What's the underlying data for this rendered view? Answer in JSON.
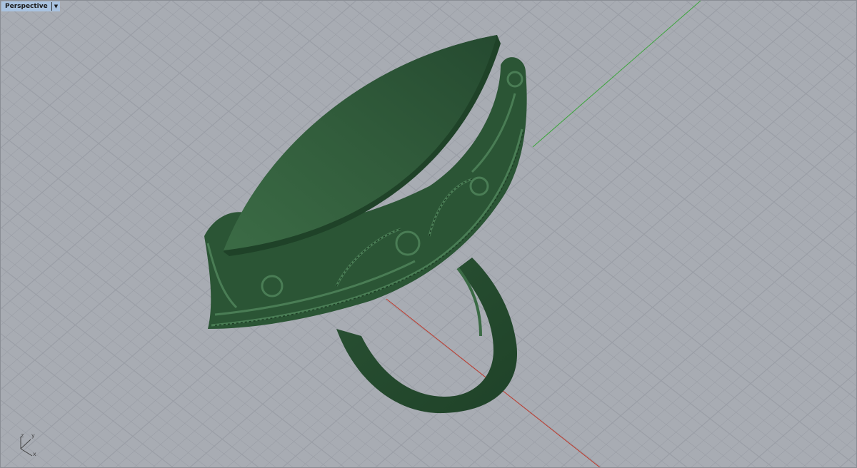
{
  "viewport": {
    "name": "Perspective",
    "menu_icon": "dropdown-arrow-icon"
  },
  "axis_widget": {
    "x": "x",
    "y": "y",
    "z": "z"
  },
  "colors": {
    "background": "#a8acb3",
    "grid": "#9a9ea6",
    "x_axis": "#c0392b",
    "y_axis": "#3aa53a",
    "model": "#2f5a3a"
  }
}
